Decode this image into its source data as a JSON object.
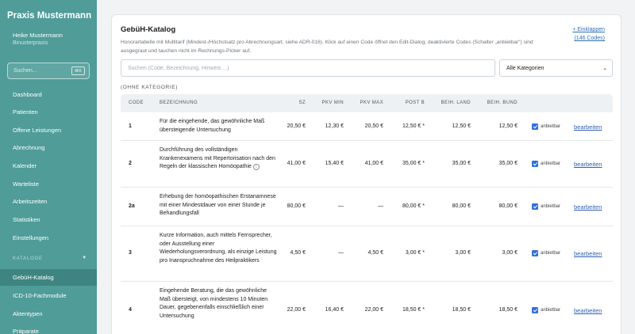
{
  "sidebar": {
    "brand": "Praxis Mustermann",
    "user_name": "Heike Mustermann",
    "user_org": "Binusterpraxis",
    "search_placeholder": "Suchen...",
    "search_shortcut": "⌘K",
    "items": [
      {
        "label": "Dashboard"
      },
      {
        "label": "Patienten"
      },
      {
        "label": "Offene Leistungen"
      },
      {
        "label": "Abrechnung"
      },
      {
        "label": "Kalender"
      },
      {
        "label": "Warteliste"
      },
      {
        "label": "Arbeitszeiten"
      },
      {
        "label": "Statistiken"
      },
      {
        "label": "Einstellungen"
      }
    ],
    "section_label": "KATALOGE",
    "section_items": [
      {
        "label": "GebüH-Katalog",
        "active": true
      },
      {
        "label": "ICD-10-Fachmodule"
      },
      {
        "label": "Aktentypen"
      },
      {
        "label": "Präparate"
      }
    ]
  },
  "main": {
    "title": "GebüH-Katalog",
    "description": "Honorartabelle mit Multitarif (Mindest-/Höchstsatz pro Abrechnungsart, siehe ADR-016). Klick auf einen Code öffnet den Edit-Dialog; deaktivierte Codes (Schalter „anbietbar“) sind ausgegraut und tauchen nicht im Rechnungs-Picker auf.",
    "collapse_label": "+ Einklappen",
    "collapse_count": "(146 Codes)",
    "search_placeholder": "Suchen (Code, Bezeichnung, Hinweis ...)",
    "category_selected": "Alle Kategorien",
    "group_label": "(OHNE KATEGORIE)",
    "columns": {
      "code": "CODE",
      "bezeichnung": "BEZEICHNUNG",
      "sz": "SZ",
      "pkv_min": "PKV MIN",
      "pkv_max": "PKV MAX",
      "post_b": "POST B",
      "beih_land": "BEIH. LAND",
      "beih_bund": "BEIH. BUND"
    },
    "rows": [
      {
        "code": "1",
        "bezeichnung": "Für die eingehende, das gewöhnliche Maß übersteigende Untersuchung",
        "info": false,
        "sz": "20,50 €",
        "pkv_min": "12,30 €",
        "pkv_max": "20,50 €",
        "post_b": "12,50 € *",
        "beih_land": "12,50 €",
        "beih_bund": "12,50 €",
        "anbietbar": "anbietbar",
        "edit": "bearbeiten"
      },
      {
        "code": "2",
        "bezeichnung": "Durchführung des vollständigen Krankenexamens mit Repertorisation nach den Regeln der klassischen Homöopathie",
        "info": true,
        "sz": "41,00 €",
        "pkv_min": "15,40 €",
        "pkv_max": "41,00 €",
        "post_b": "35,00 € *",
        "beih_land": "35,00 €",
        "beih_bund": "35,00 €",
        "anbietbar": "anbietbar",
        "edit": "bearbeiten"
      },
      {
        "code": "2a",
        "bezeichnung": "Erhebung der homöopathischen Erstanamnese mit einer Mindestdauer von einer Stunde je Behandlungsfall",
        "info": false,
        "sz": "80,00 €",
        "pkv_min": "—",
        "pkv_max": "—",
        "post_b": "80,00 € *",
        "beih_land": "80,00 €",
        "beih_bund": "80,00 €",
        "anbietbar": "anbietbar",
        "edit": "bearbeiten"
      },
      {
        "code": "3",
        "bezeichnung": "Kurze Information, auch mittels Fernsprecher, oder Ausstellung einer Wiederholungsverordnung, als einzige Leistung pro Inanspruchnahme des Heilpraktikers",
        "info": false,
        "sz": "4,50 €",
        "pkv_min": "—",
        "pkv_max": "4,50 €",
        "post_b": "3,00 € *",
        "beih_land": "3,00 €",
        "beih_bund": "3,00 €",
        "anbietbar": "anbietbar",
        "edit": "bearbeiten"
      },
      {
        "code": "4",
        "bezeichnung": "Eingehende Beratung, die das gewöhnliche Maß übersteigt, von mindestens 10 Minuten Dauer, gegebenenfalls einschließlich einer Untersuchung",
        "info": false,
        "sz": "22,00 €",
        "pkv_min": "16,40 €",
        "pkv_max": "22,00 €",
        "post_b": "18,50 € *",
        "beih_land": "18,50 €",
        "beih_bund": "18,50 €",
        "anbietbar": "anbietbar",
        "edit": "bearbeiten"
      }
    ]
  },
  "colors": {
    "sidebar_bg": "#4f9c98",
    "sidebar_active": "#3e8581",
    "link": "#2f5fb0",
    "checkbox": "#2f6fdb"
  }
}
